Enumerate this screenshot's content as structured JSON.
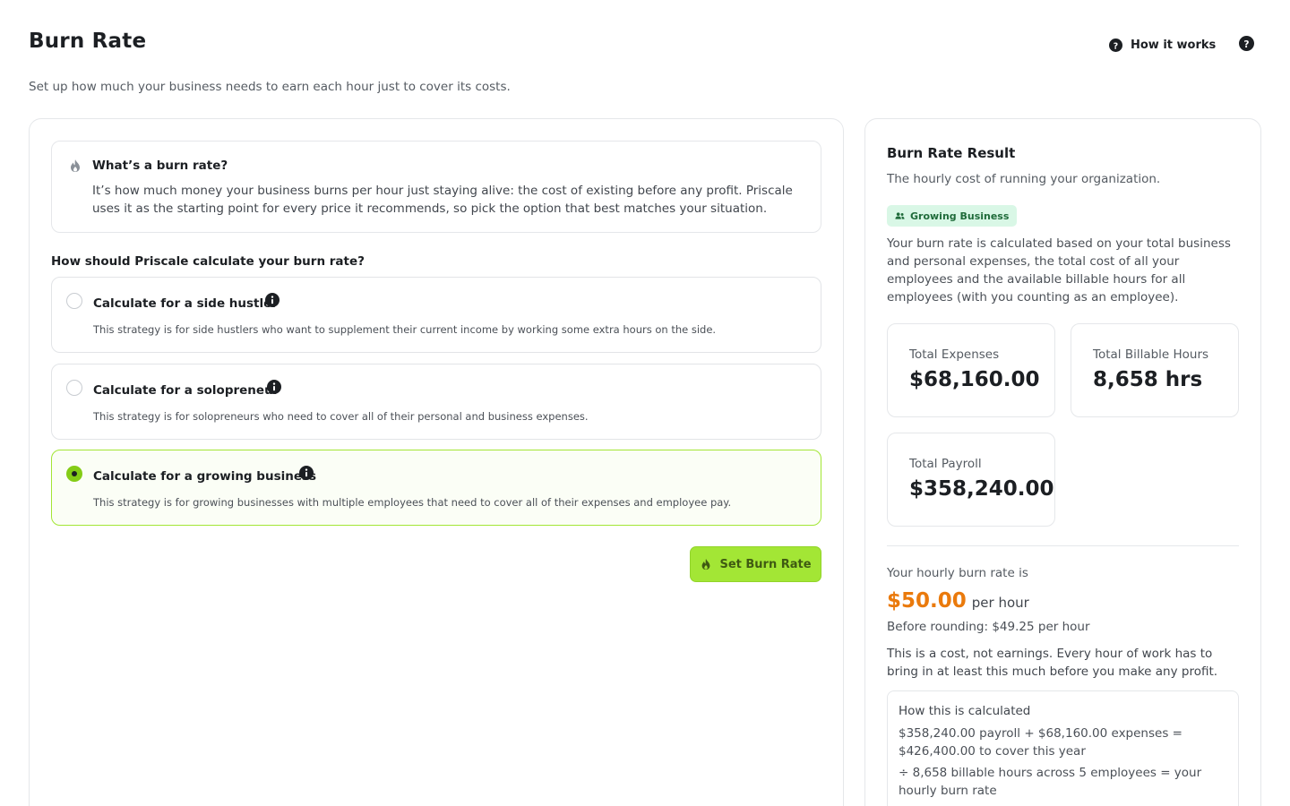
{
  "header": {
    "title": "Burn Rate",
    "subtitle": "Set up how much your business needs to earn each hour just to cover its costs.",
    "how_it_works": "How it works"
  },
  "info": {
    "title": "What’s a burn rate?",
    "text": "It’s how much money your business burns per hour just staying alive: the cost of existing before any profit. Priscale uses it as the starting point for every price it recommends, so pick the option that best matches your situation."
  },
  "question": "How should Priscale calculate your burn rate?",
  "options": [
    {
      "title": "Calculate for a side hustler",
      "description": "This strategy is for side hustlers who want to supplement their current income by working some extra hours on the side.",
      "selected": false
    },
    {
      "title": "Calculate for a solopreneur",
      "description": "This strategy is for solopreneurs who need to cover all of their personal and business expenses.",
      "selected": false
    },
    {
      "title": "Calculate for a growing business",
      "description": "This strategy is for growing businesses with multiple employees that need to cover all of their expenses and employee pay.",
      "selected": true
    }
  ],
  "set_button": "Set Burn Rate",
  "result": {
    "title": "Burn Rate Result",
    "subtitle": "The hourly cost of running your organization.",
    "badge": "Growing Business",
    "description": "Your burn rate is calculated based on your total business and personal expenses, the total cost of all your employees and the available billable hours for all employees (with you counting as an employee).",
    "stats": {
      "expenses_label": "Total Expenses",
      "expenses_value": "$68,160.00",
      "hours_label": "Total Billable Hours",
      "hours_value": "8,658 hrs",
      "payroll_label": "Total Payroll",
      "payroll_value": "$358,240.00"
    },
    "hourly_label": "Your hourly burn rate is",
    "hourly_value": "$50.00",
    "hourly_unit": "per hour",
    "before_rounding": "Before rounding: $49.25 per hour",
    "cost_note": "This is a cost, not earnings. Every hour of work has to bring in at least this much before you make any profit.",
    "calc": {
      "title": "How this is calculated",
      "line1": "$358,240.00 payroll + $68,160.00 expenses = $426,400.00 to cover this year",
      "line2": "÷ 8,658 billable hours across 5 employees = your hourly burn rate"
    }
  },
  "colors": {
    "accent": "#a3e635",
    "accent_dark": "#84cc16",
    "burn_rate": "#ea7a0c",
    "badge_bg": "#d9f7e6"
  },
  "icons": {
    "how_it_works": "question-circle-icon",
    "help": "question-circle-icon",
    "info_box": "flame-icon",
    "option_info": "info-circle-icon",
    "set_button": "flame-icon",
    "badge": "users-icon"
  }
}
